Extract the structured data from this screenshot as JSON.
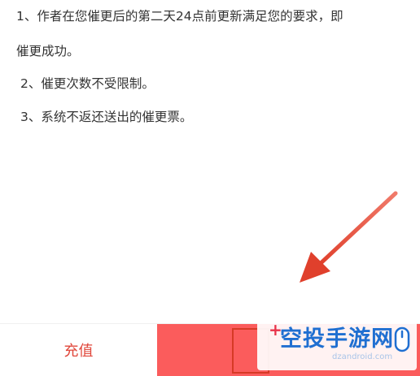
{
  "rules": {
    "rule1_line1": "1、作者在您催更后的第二天24点前更新满足您的要求，即",
    "rule1_line2": "催更成功。",
    "rule2": "2、催更次数不受限制。",
    "rule3": "3、系统不返还送出的催更票。"
  },
  "bottom_bar": {
    "recharge_label": "充值",
    "recharge_color": "#e0463a",
    "confirm_color": "#fb5c5c"
  },
  "annotation": {
    "arrow_color": "#e0402c",
    "highlight_color": "#d63a26"
  },
  "watermark": {
    "plus": "+",
    "text": "空投手游网",
    "sub": "dzandroid.com"
  }
}
